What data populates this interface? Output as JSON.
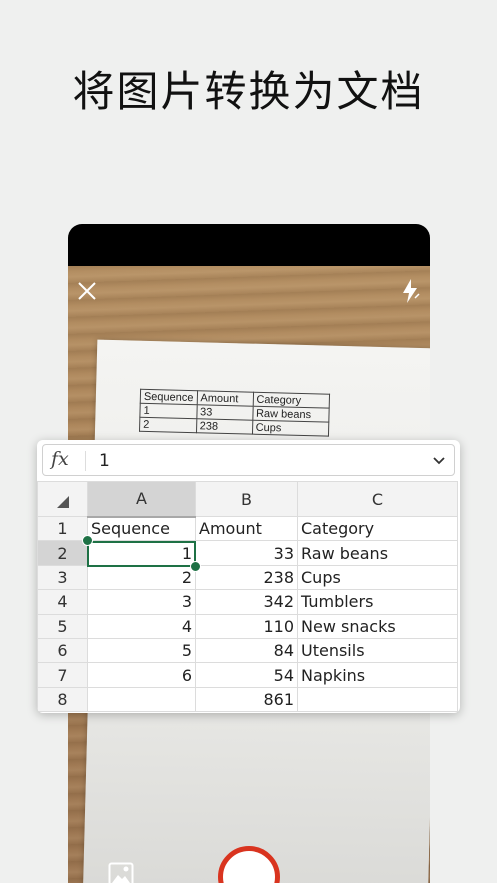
{
  "headline": "将图片转换为文档",
  "camera": {
    "close_icon": "close-icon",
    "flash_icon": "flash-icon",
    "gallery_icon": "image-gallery-icon",
    "shutter_color": "#d9341f",
    "paper_table": [
      [
        "Sequence",
        "Amount",
        "Category"
      ],
      [
        "1",
        "33",
        "Raw beans"
      ],
      [
        "2",
        "238",
        "Cups"
      ]
    ]
  },
  "sheet": {
    "formula_label": "fx",
    "formula_value": "1",
    "columns": [
      "A",
      "B",
      "C"
    ],
    "rows": [
      {
        "num": "1",
        "a": "Sequence",
        "b": "Amount",
        "c": "Category"
      },
      {
        "num": "2",
        "a": "1",
        "b": "33",
        "c": "Raw beans"
      },
      {
        "num": "3",
        "a": "2",
        "b": "238",
        "c": "Cups"
      },
      {
        "num": "4",
        "a": "3",
        "b": "342",
        "c": "Tumblers"
      },
      {
        "num": "5",
        "a": "4",
        "b": "110",
        "c": "New snacks"
      },
      {
        "num": "6",
        "a": "5",
        "b": "84",
        "c": "Utensils"
      },
      {
        "num": "7",
        "a": "6",
        "b": "54",
        "c": "Napkins"
      },
      {
        "num": "8",
        "a": "",
        "b": "861",
        "c": ""
      }
    ],
    "selection_color": "#1e7145"
  }
}
